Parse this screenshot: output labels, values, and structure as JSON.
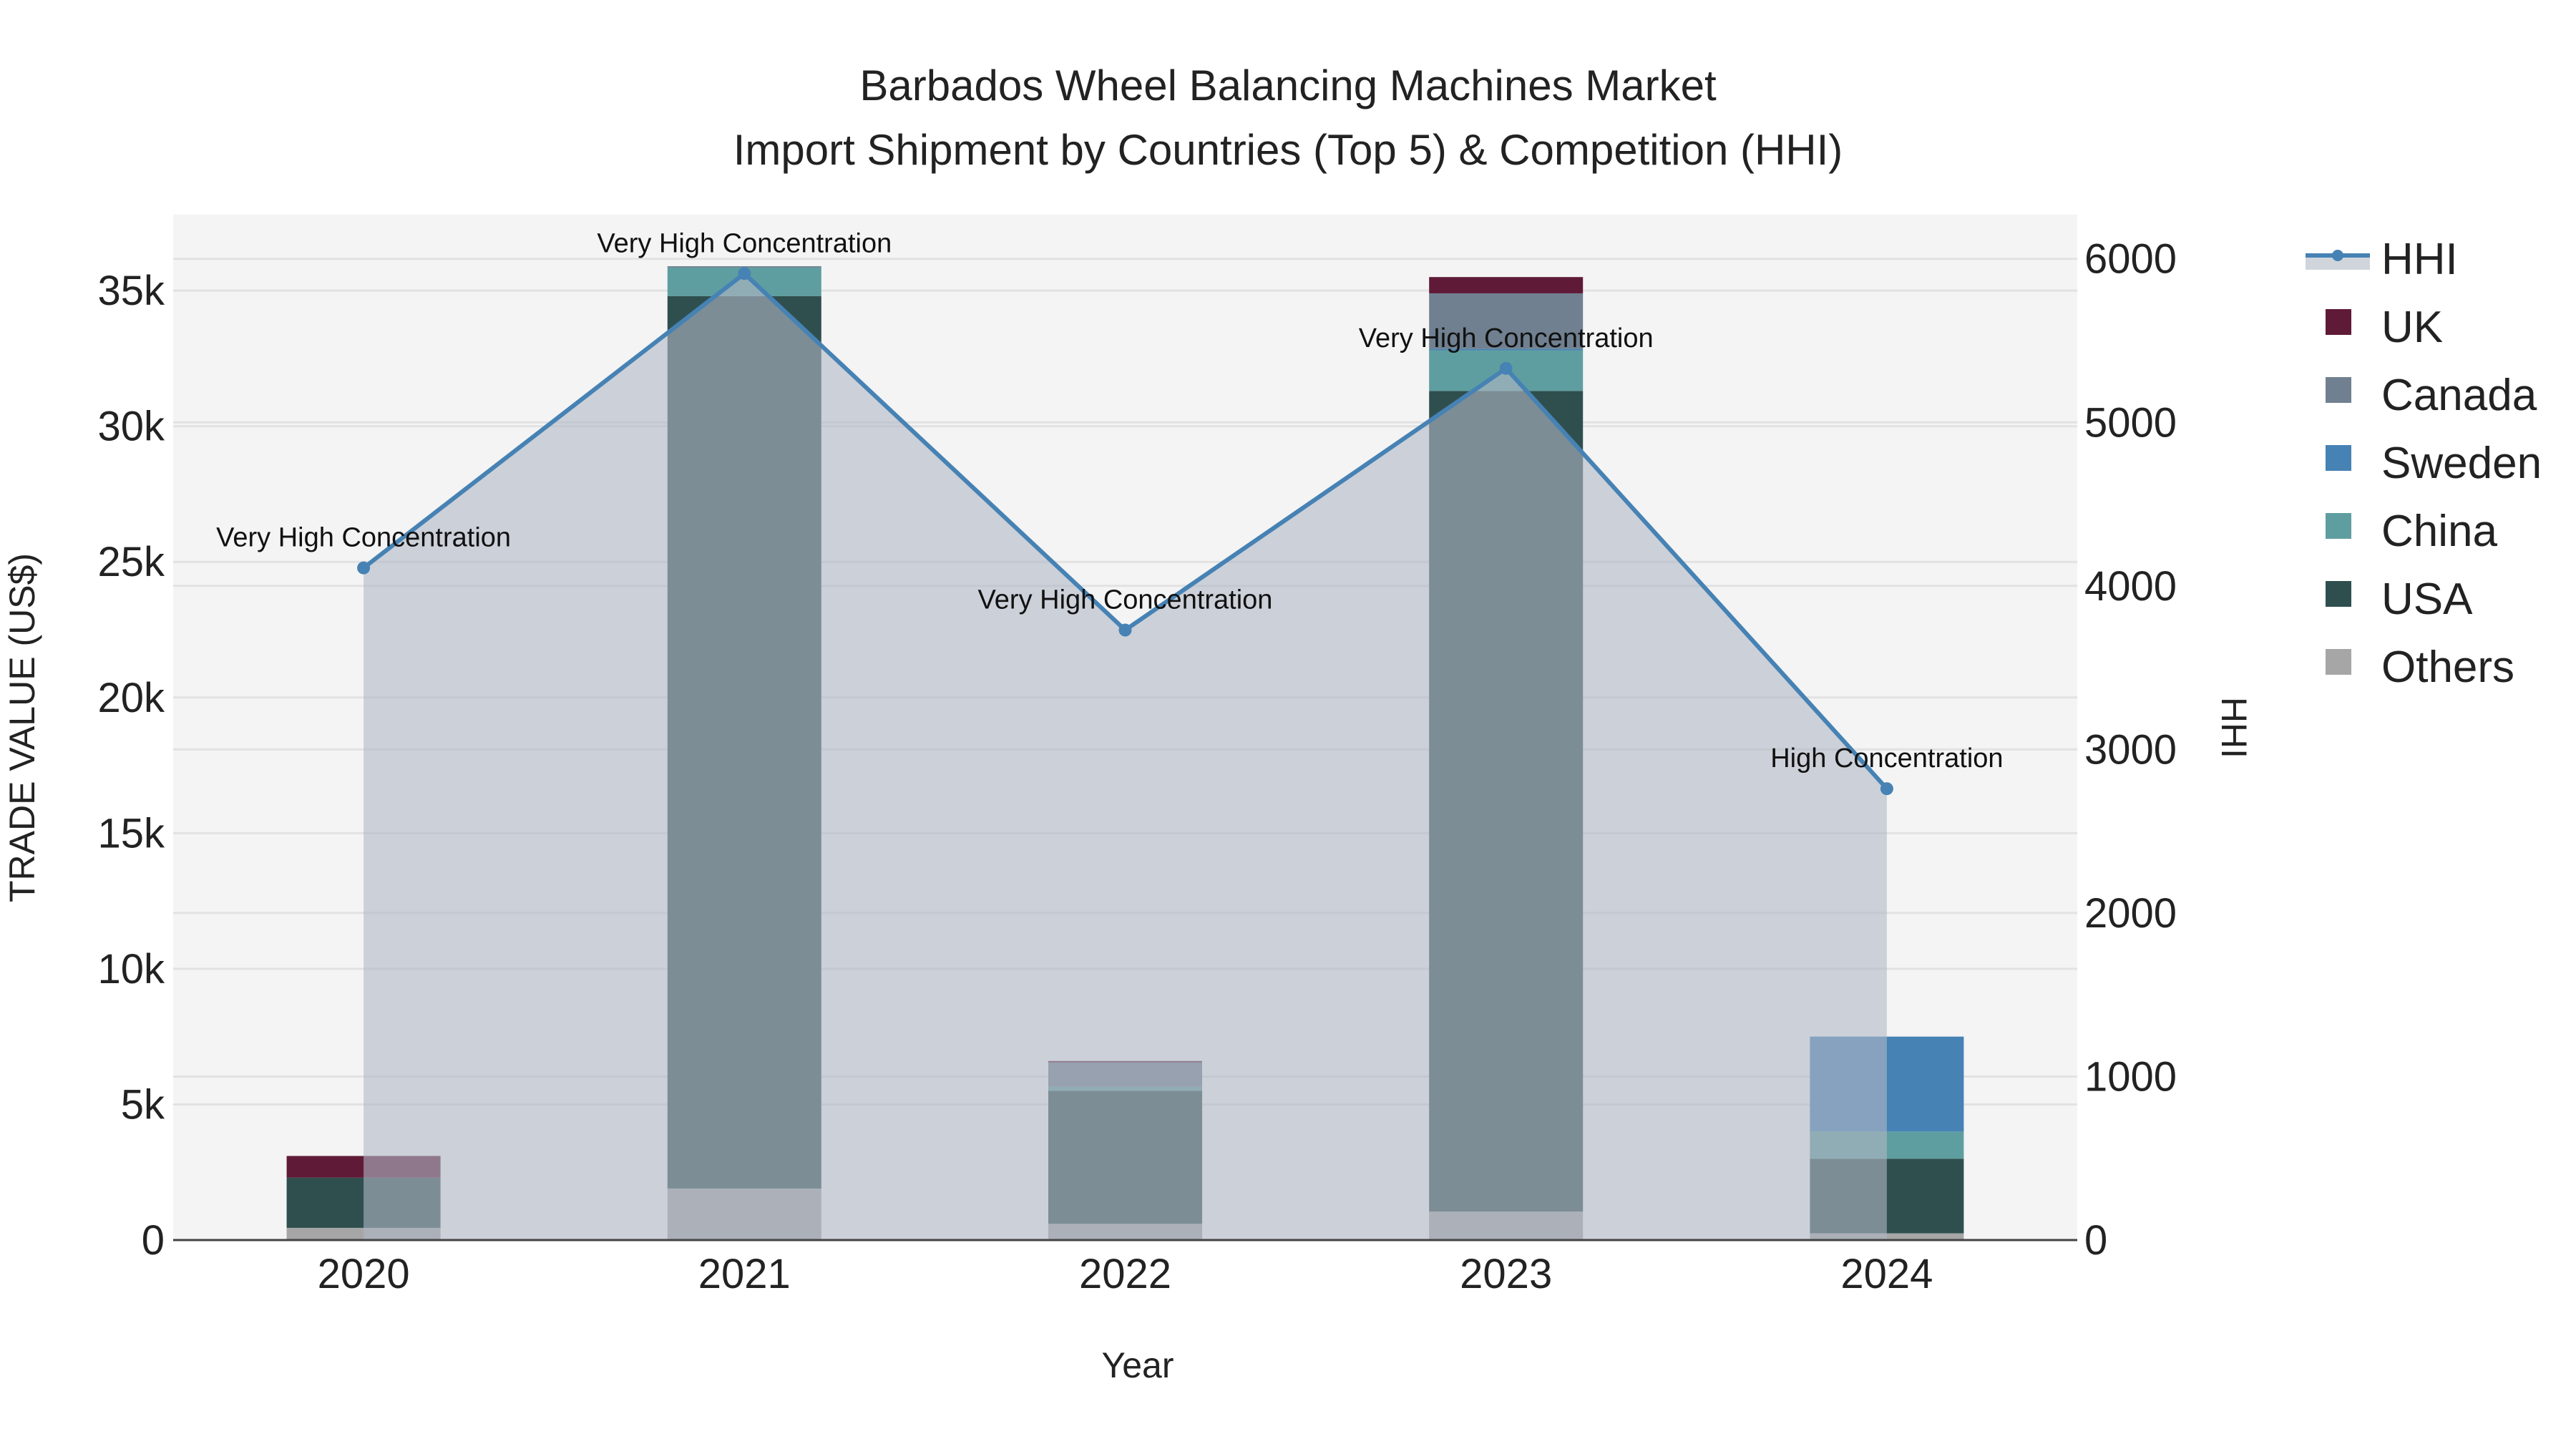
{
  "chart_data": {
    "type": "bar",
    "title": "Barbados Wheel Balancing Machines Market",
    "subtitle": "Import Shipment by Countries (Top 5) & Competition (HHI)",
    "xlabel": "Year",
    "ylabel": "TRADE VALUE (US$)",
    "y2label": "HHI",
    "categories": [
      "2020",
      "2021",
      "2022",
      "2023",
      "2024"
    ],
    "ylim": [
      0,
      37800
    ],
    "y2lim": [
      0,
      6270
    ],
    "yticks": [
      0,
      5000,
      10000,
      15000,
      20000,
      25000,
      30000,
      35000
    ],
    "ytick_labels": [
      "0",
      "5k",
      "10k",
      "15k",
      "20k",
      "25k",
      "30k",
      "35k"
    ],
    "y2ticks": [
      0,
      1000,
      2000,
      3000,
      4000,
      5000,
      6000
    ],
    "y2tick_labels": [
      "0",
      "1000",
      "2000",
      "3000",
      "4000",
      "5000",
      "6000"
    ],
    "series": [
      {
        "name": "Others",
        "color": "#a6a6a6",
        "values": [
          450,
          1900,
          600,
          1050,
          250
        ]
      },
      {
        "name": "USA",
        "color": "#2f4f4f",
        "values": [
          1850,
          32900,
          4900,
          30250,
          2750
        ]
      },
      {
        "name": "China",
        "color": "#5f9ea0",
        "values": [
          0,
          1050,
          150,
          1500,
          1000
        ]
      },
      {
        "name": "Sweden",
        "color": "#4682b4",
        "values": [
          0,
          0,
          0,
          50,
          3500
        ]
      },
      {
        "name": "Canada",
        "color": "#708090",
        "values": [
          0,
          50,
          900,
          2050,
          0
        ]
      },
      {
        "name": "UK",
        "color": "#5f1a37",
        "values": [
          800,
          0,
          50,
          600,
          0
        ]
      }
    ],
    "hhi": {
      "name": "HHI",
      "color": "#4682b4",
      "values": [
        4110,
        5910,
        3730,
        5330,
        2760
      ],
      "annotations": [
        "Very High Concentration",
        "Very High Concentration",
        "Very High Concentration",
        "Very High Concentration",
        "High Concentration"
      ]
    },
    "legend_order": [
      "HHI",
      "UK",
      "Canada",
      "Sweden",
      "China",
      "USA",
      "Others"
    ],
    "legend_position": "right",
    "grid": true
  }
}
